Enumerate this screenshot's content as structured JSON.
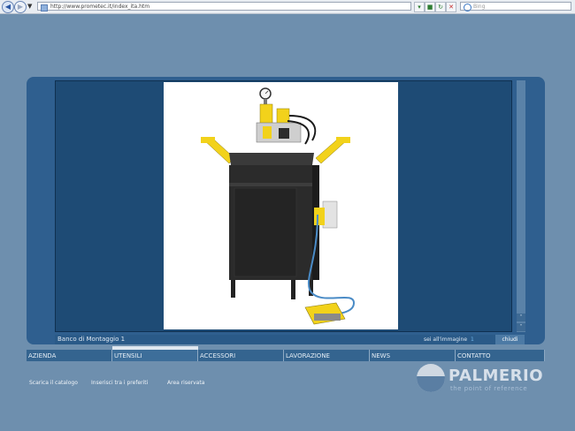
{
  "browser": {
    "url": "http://www.prometec.it/index_ita.htm",
    "search_placeholder": "Bing"
  },
  "viewer": {
    "caption": "Banco di Montaggio  1",
    "image_label": "sei all'immagine",
    "image_index": "1",
    "close_label": "chiudi",
    "scroll_up": "˄",
    "scroll_down": "˅"
  },
  "menu": [
    {
      "label": "AZIENDA"
    },
    {
      "label": "UTENSILI"
    },
    {
      "label": "ACCESSORI"
    },
    {
      "label": "LAVORAZIONE"
    },
    {
      "label": "NEWS"
    },
    {
      "label": "CONTATTO"
    }
  ],
  "footer": {
    "catalog": "Scarica il catalogo",
    "favorites": "Inserisci tra i preferiti",
    "reserved": "Area riservata"
  },
  "logo": {
    "name": "PALMERIO",
    "tagline": "the point of reference"
  },
  "colors": {
    "page_bg": "#6e8fae",
    "panel": "#2f5f8f",
    "machine_yellow": "#f2d21b",
    "machine_body": "#2b2b2b"
  }
}
